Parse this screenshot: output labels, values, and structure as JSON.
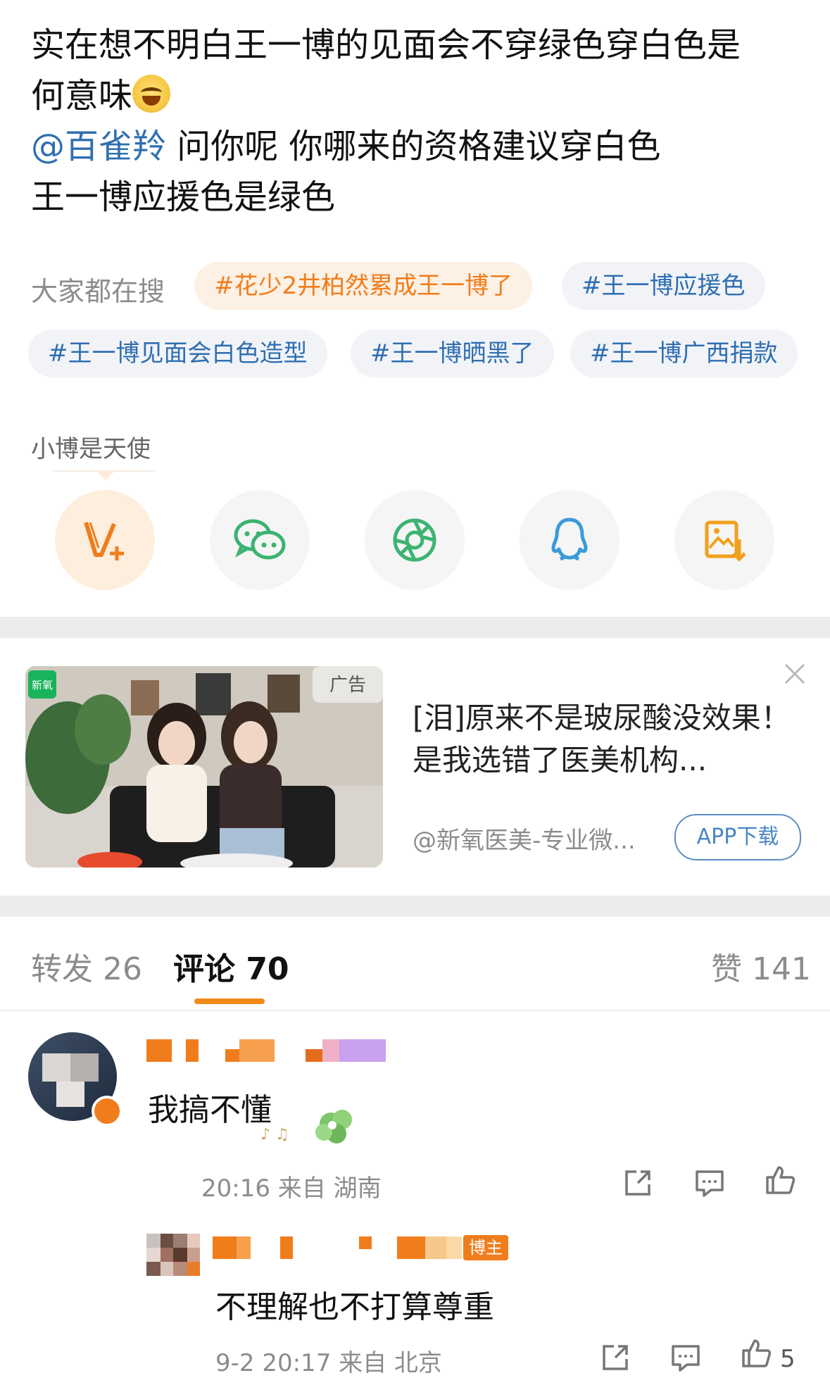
{
  "post": {
    "line1": "实在想不明白王一博的见面会不穿绿色穿白色是",
    "line2_text": "何意味",
    "line2_emoji": "laughing-tears-emoji",
    "mention": "@百雀羚",
    "line3_rest": " 问你呢 你哪来的资格建议穿白色",
    "line4": "王一博应援色是绿色"
  },
  "search": {
    "label": "大家都在搜",
    "tags": [
      "#花少2井柏然累成王一博了",
      "#王一博应援色",
      "#王一博见面会白色造型",
      "#王一博晒黑了",
      "#王一博广西捐款"
    ]
  },
  "dedicate": {
    "label": "小博是天使"
  },
  "share": {
    "icons": [
      "vplus-icon",
      "wechat-icon",
      "moments-icon",
      "qq-icon",
      "save-image-icon"
    ],
    "colors": {
      "vplus": "#f07d1c",
      "wechat": "#3cb371",
      "moments": "#3cb371",
      "qq": "#3a9ad9",
      "save": "#f0a01c"
    }
  },
  "ad": {
    "badge": "广告",
    "logo": "新氧",
    "title": "[泪]原来不是玻尿酸没效果！是我选错了医美机构...",
    "source": "@新氧医美-专业微...",
    "button": "APP下载"
  },
  "tabs": {
    "repost": "转发 26",
    "comments": "评论 70",
    "likes": "赞 141"
  },
  "comment": {
    "text": "我搞不懂",
    "meta": "20:16 来自 湖南",
    "reply": {
      "badge": "博主",
      "text": "不理解也不打算尊重",
      "meta": "9-2 20:17 来自 北京",
      "like_count": "5"
    }
  },
  "accent": "#f07d1c"
}
